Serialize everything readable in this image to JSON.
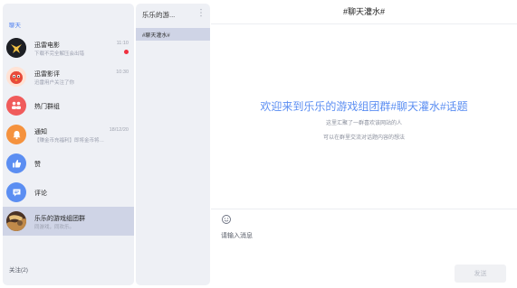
{
  "sidebar": {
    "section_label": "聊天",
    "conversations": [
      {
        "title": "迅雷电影",
        "subtitle": "下载不完全解压会出错",
        "time": "11:10",
        "unread": true,
        "avatar": "thunder-movie-logo"
      },
      {
        "title": "迅雷影评",
        "subtitle": "迅雷用户关注了你",
        "time": "10:30",
        "avatar": "thunder-review-bird"
      },
      {
        "title": "热门群组",
        "avatar": "group-icon",
        "color": "#f05b5b"
      },
      {
        "title": "通知",
        "subtitle": "【赚金币充福利】即将金币将…",
        "time": "18/12/20",
        "avatar": "bell-icon",
        "color": "#f5923e"
      },
      {
        "title": "赞",
        "avatar": "thumb-up-icon",
        "color": "#5b8ef2"
      },
      {
        "title": "评论",
        "avatar": "comment-icon",
        "color": "#5b8ef2"
      },
      {
        "title": "乐乐的游戏组团群",
        "subtitle": "同游戏，同欢乐。",
        "avatar": "game-group-photo"
      }
    ],
    "footer": "关注(2)"
  },
  "channel": {
    "name": "乐乐的游...",
    "topic": "#聊天灌水#"
  },
  "chat": {
    "title": "#聊天灌水#",
    "welcome_title": "欢迎来到乐乐的游戏组团群#聊天灌水#话题",
    "welcome_line1": "这里汇聚了一群喜欢该网站的人",
    "welcome_line2": "可以在群里交流对话题内容的想法",
    "input_placeholder": "请输入消息",
    "send_label": "发送"
  },
  "colors": {
    "accent": "#5b8ef2",
    "unread_dot": "#f0303f",
    "active_row": "#cfd4e6"
  }
}
